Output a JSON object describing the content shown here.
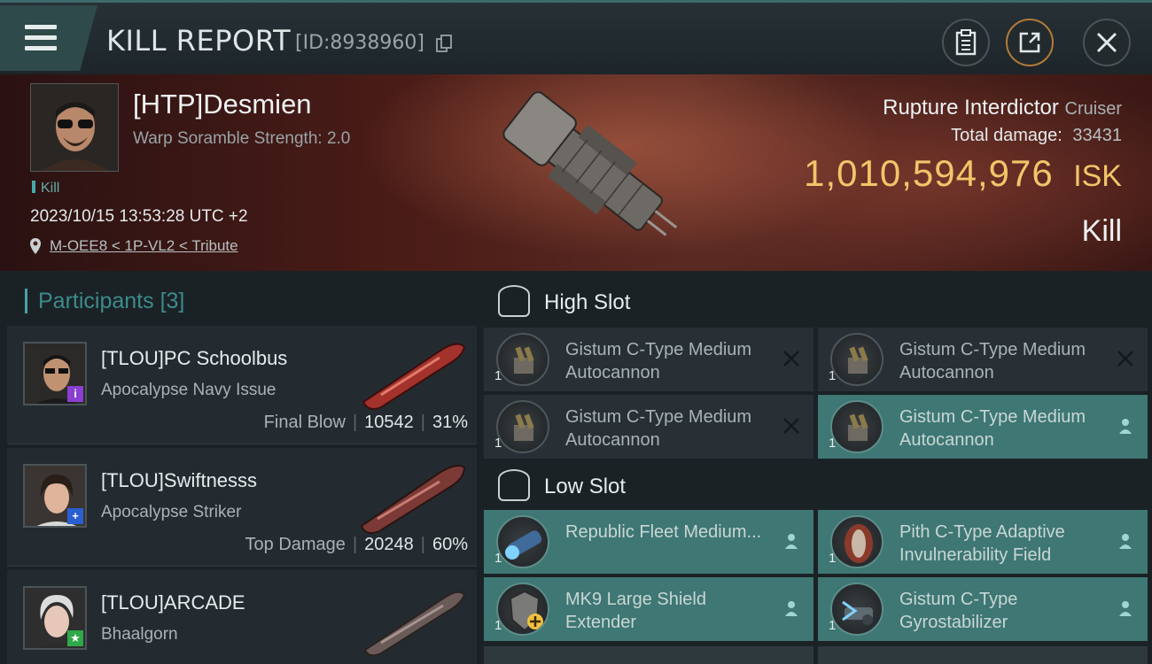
{
  "header": {
    "title": "KILL REPORT",
    "report_id": "[ID:8938960]"
  },
  "victim": {
    "pilot_name": "[HTP]Desmien",
    "detail": "Warp Soramble Strength: 2.0",
    "tag": "Kill",
    "datetime": "2023/10/15 13:53:28 UTC +2",
    "location": "M-OEE8 < 1P-VL2 < Tribute",
    "ship_name": "Rupture Interdictor",
    "ship_class": "Cruiser",
    "total_damage_label": "Total damage:",
    "total_damage": "33431",
    "isk_value": "1,010,594,976",
    "currency": "ISK",
    "result": "Kill"
  },
  "participants": {
    "title": "Participants",
    "count": "[3]",
    "items": [
      {
        "name": "[TLOU]PC Schoolbus",
        "ship": "Apocalypse Navy Issue",
        "role": "Final Blow",
        "damage": "10542",
        "percent": "31%",
        "badge": "i",
        "badge_color": "#8a3fd1"
      },
      {
        "name": "[TLOU]Swiftnesss",
        "ship": "Apocalypse Striker",
        "role": "Top Damage",
        "damage": "20248",
        "percent": "60%",
        "badge": "+",
        "badge_color": "#2a5fd1"
      },
      {
        "name": "[TLOU]ARCADE",
        "ship": "Bhaalgorn",
        "badge": "★",
        "badge_color": "#2fa84a"
      }
    ]
  },
  "slots": {
    "high": {
      "label": "High Slot",
      "modules": [
        {
          "name": "Gistum C-Type Medium Autocannon",
          "qty": "1",
          "state": "destroyed"
        },
        {
          "name": "Gistum C-Type Medium Autocannon",
          "qty": "1",
          "state": "destroyed"
        },
        {
          "name": "Gistum C-Type Medium Autocannon",
          "qty": "1",
          "state": "destroyed"
        },
        {
          "name": "Gistum C-Type Medium Autocannon",
          "qty": "1",
          "state": "dropped"
        }
      ]
    },
    "low": {
      "label": "Low Slot",
      "modules": [
        {
          "name": "Republic Fleet Medium...",
          "qty": "1",
          "state": "dropped"
        },
        {
          "name": "Pith C-Type Adaptive Invulnerability Field",
          "qty": "1",
          "state": "dropped"
        },
        {
          "name": "MK9 Large Shield Extender",
          "qty": "1",
          "state": "dropped"
        },
        {
          "name": "Gistum C-Type Gyrostabilizer",
          "qty": "1",
          "state": "dropped"
        }
      ]
    }
  },
  "colors": {
    "accent_teal": "#49a3a3",
    "isk_gold": "#f2c56a",
    "fitted_bg": "#3e7773",
    "destroyed_bg": "#283035"
  }
}
